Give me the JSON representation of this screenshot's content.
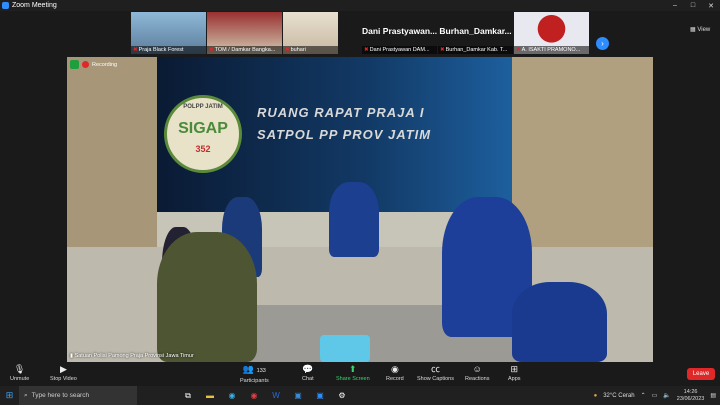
{
  "window": {
    "title": "Zoom Meeting",
    "controls": [
      "–",
      "□",
      "✕"
    ]
  },
  "gallery": {
    "tiles": [
      {
        "name": "Praja Black Forest"
      },
      {
        "name": "TOM / Damkar Bangka..."
      },
      {
        "name": "buhari"
      },
      {
        "name": "Dani Prastyawan DAM...",
        "big": "Dani  Prastyawan..."
      },
      {
        "name": "Burhan_Damkar Kab. T...",
        "big": "Burhan_Damkar..."
      },
      {
        "name": "A. ISAKTI PRAMONO..."
      }
    ],
    "next_icon": "chevron-right-icon",
    "view_label": "View"
  },
  "stage": {
    "recording_label": "Recording",
    "banner_line1": "RUANG RAPAT PRAJA I",
    "banner_line2": "SATPOL PP PROV JATIM",
    "logo_top": "POLPP   JATIM",
    "logo_main": "SIGAP",
    "logo_num": "352",
    "caption": "Satuan Polisi Pamong Praja Provinsi Jawa Timur"
  },
  "toolbar": {
    "unmute": "Unmute",
    "stop_video": "Stop Video",
    "participants": "Participants",
    "participants_count": "133",
    "chat": "Chat",
    "share_screen": "Share Screen",
    "record": "Record",
    "show_captions": "Show Captions",
    "reactions": "Reactions",
    "apps": "Apps",
    "leave": "Leave"
  },
  "taskbar": {
    "search_placeholder": "Type here to search",
    "weather": "32°C  Cerah",
    "time": "14:26",
    "date": "23/06/2023"
  }
}
